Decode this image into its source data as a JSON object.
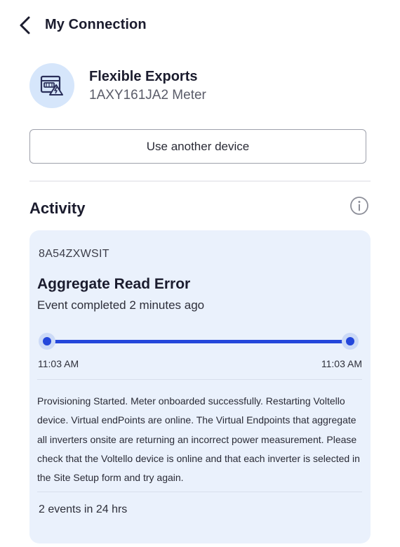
{
  "header": {
    "title": "My Connection",
    "back_icon": "chevron-left-icon"
  },
  "device": {
    "name": "Flexible Exports",
    "id": "1AXY161JA2 Meter",
    "icon": "meter-icon",
    "avatar_color": "#d6e6fb"
  },
  "actions": {
    "use_another_device": "Use another device"
  },
  "activity": {
    "title": "Activity",
    "info_icon": "info-icon",
    "event": {
      "code": "8A54ZXWSIT",
      "title": "Aggregate Read Error",
      "subtitle": "Event completed 2 minutes ago",
      "start_time": "11:03 AM",
      "end_time": "11:03 AM",
      "progress": 1.0,
      "description": "Provisioning Started.  Meter onboarded successfully.  Restarting Voltello device.  Virtual endPoints are online.  The Virtual Endpoints that aggregate all inverters onsite are returning an incorrect power measurement. Please check that the Voltello device is online and that each inverter is selected in the Site Setup form and try again.",
      "count_text": "2 events in 24 hrs"
    }
  },
  "colors": {
    "accent": "#2447db",
    "card_bg": "#eaf1fc",
    "text_primary": "#1b1c2e"
  }
}
